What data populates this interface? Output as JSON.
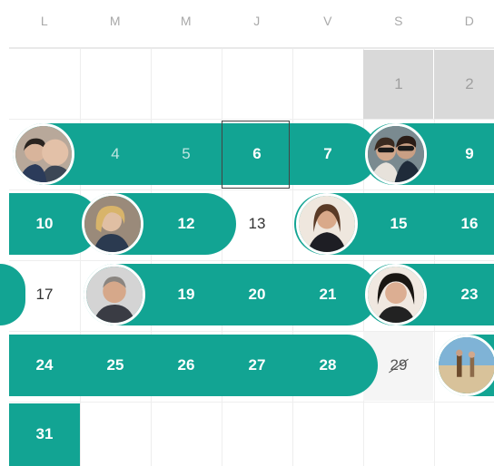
{
  "weekdays": [
    "L",
    "M",
    "M",
    "J",
    "V",
    "S",
    "D"
  ],
  "days": {
    "d1": "1",
    "d2": "2",
    "d4": "4",
    "d5": "5",
    "d6": "6",
    "d7": "7",
    "d9": "9",
    "d10": "10",
    "d12": "12",
    "d13": "13",
    "d15": "15",
    "d16": "16",
    "d17": "17",
    "d19": "19",
    "d20": "20",
    "d21": "21",
    "d23": "23",
    "d24": "24",
    "d25": "25",
    "d26": "26",
    "d27": "27",
    "d28": "28",
    "d29": "29",
    "d31": "31"
  },
  "colors": {
    "booking": "#12a493",
    "booking_dim_text": "#bfe6e1",
    "other_month": "#d9d9d9",
    "today_border": "#444444"
  }
}
